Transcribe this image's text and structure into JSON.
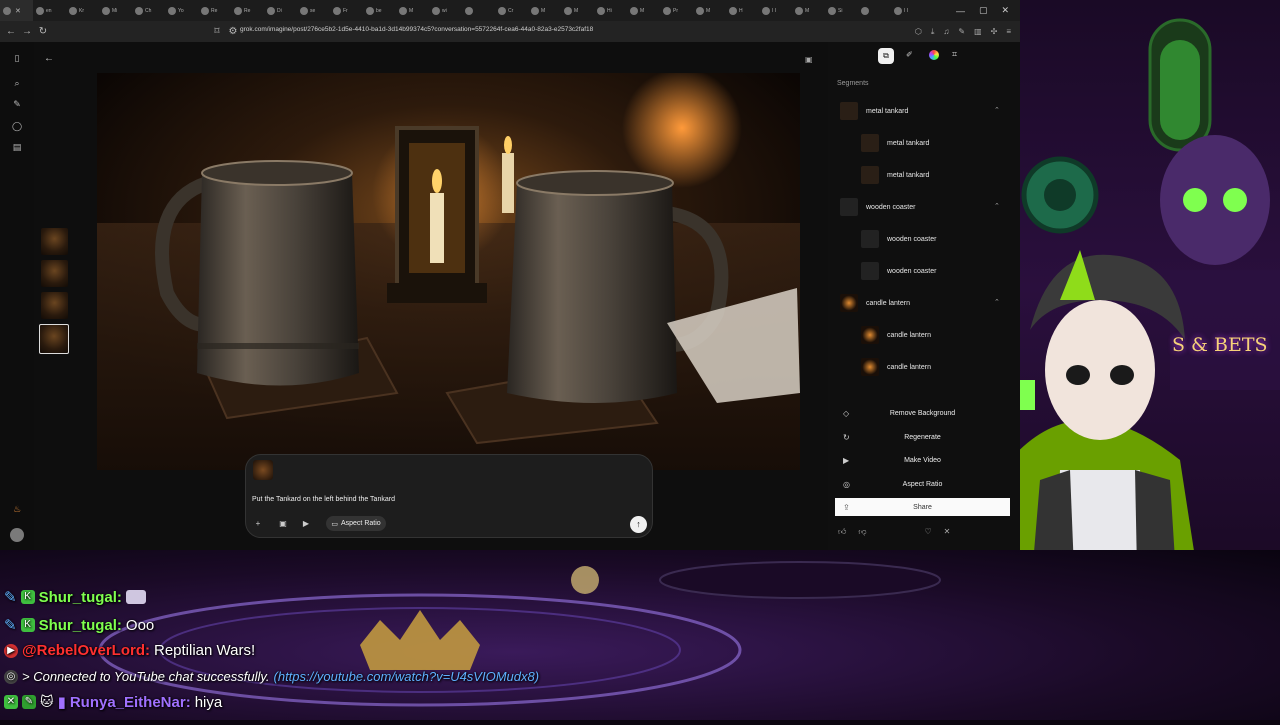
{
  "browser": {
    "tab_titles": [
      "",
      "en",
      "Kr",
      "Mi",
      "Ch",
      "Yo",
      "Re",
      "Re",
      "Di",
      "se",
      "Fr",
      "be",
      "M",
      "wi",
      "",
      "Cr",
      "M",
      "M",
      "Hi",
      "M",
      "Pr",
      "M",
      "H",
      "I I",
      "M",
      "Si",
      "",
      "I I"
    ],
    "url": "grok.com/imagine/post/276ce5b2-1d5e-4410-ba1d-3d14b99374c5?conversation=5572264f-cea6-44a0-82a3-e2573c2faf18"
  },
  "composer": {
    "prompt": "Put the Tankard on the left behind the Tankard",
    "aspect_ratio_label": "Aspect Ratio"
  },
  "panel": {
    "segments_title": "Segments",
    "groups": [
      {
        "label": "metal tankard",
        "children": [
          "metal tankard",
          "metal tankard"
        ]
      },
      {
        "label": "wooden coaster",
        "children": [
          "wooden coaster",
          "wooden coaster"
        ]
      },
      {
        "label": "candle lantern",
        "children": [
          "candle lantern",
          "candle lantern"
        ]
      }
    ],
    "actions": {
      "remove_background": "Remove Background",
      "regenerate": "Regenerate",
      "make_video": "Make Video",
      "aspect_ratio": "Aspect Ratio",
      "share": "Share"
    }
  },
  "chat": [
    {
      "user": "Shur_tugal:",
      "message": ""
    },
    {
      "user": "Shur_tugal:",
      "message": "Ooo"
    },
    {
      "user": "@RebelOverLord:",
      "message": "Reptilian Wars!"
    },
    {
      "system": "> Connected to YouTube chat successfully.",
      "link": "(https://youtube.com/watch?v=U4sVIOMudx8)"
    },
    {
      "user": "Runya_EitheNar:",
      "message": "hiya"
    }
  ],
  "overlay": {
    "sign": "S & BETS"
  },
  "colors": {
    "accent_green": "#7fff4f",
    "chat_red": "#ff3030",
    "purple": "#a070ff"
  }
}
